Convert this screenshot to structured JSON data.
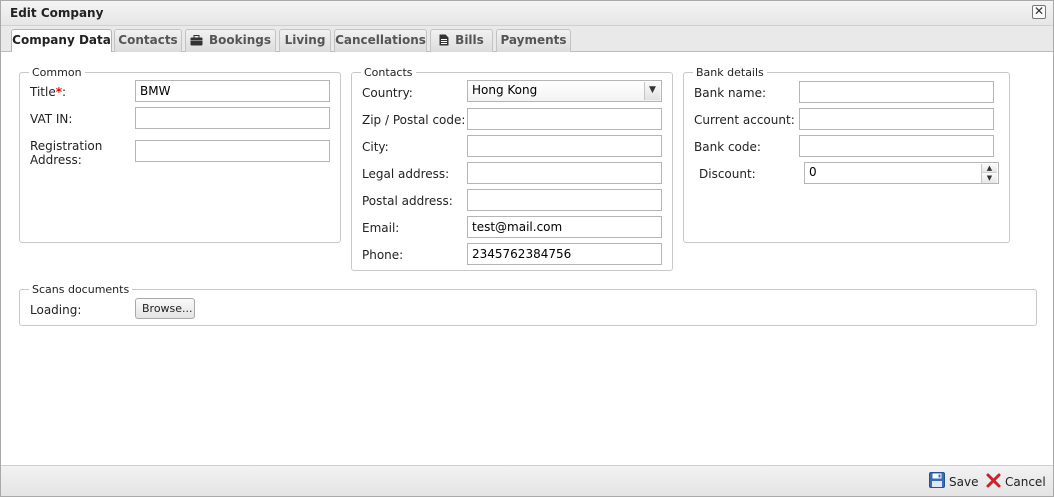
{
  "window": {
    "title": "Edit Company",
    "close_glyph": "✕"
  },
  "tabs": [
    {
      "label": "Company Data",
      "active": true
    },
    {
      "label": "Contacts"
    },
    {
      "label": "Bookings",
      "icon": "briefcase-icon"
    },
    {
      "label": "Living"
    },
    {
      "label": "Cancellations"
    },
    {
      "label": "Bills",
      "icon": "document-icon"
    },
    {
      "label": "Payments"
    }
  ],
  "common": {
    "legend": "Common",
    "title_label": "Title",
    "required_mark": "*",
    "title_colon": ":",
    "title_value": "BMW",
    "vat_label": "VAT IN:",
    "vat_value": "",
    "reg_label_line1": "Registration",
    "reg_label_line2": "Address:",
    "reg_value": ""
  },
  "contacts": {
    "legend": "Contacts",
    "country_label": "Country:",
    "country_value": "Hong Kong",
    "zip_label": "Zip / Postal code:",
    "zip_value": "",
    "city_label": "City:",
    "city_value": "",
    "legal_label": "Legal address:",
    "legal_value": "",
    "postal_label": "Postal address:",
    "postal_value": "",
    "email_label": "Email:",
    "email_value": "test@mail.com",
    "phone_label": "Phone:",
    "phone_value": "2345762384756"
  },
  "bank": {
    "legend": "Bank details",
    "bank_name_label": "Bank name:",
    "bank_name_value": "",
    "current_account_label": "Current account:",
    "current_account_value": "",
    "bank_code_label": "Bank code:",
    "bank_code_value": "",
    "discount_label": "Discount:",
    "discount_value": "0"
  },
  "scans": {
    "legend": "Scans documents",
    "loading_label": "Loading:",
    "browse_label": "Browse..."
  },
  "footer": {
    "save_label": "Save",
    "cancel_label": "Cancel"
  },
  "colors": {
    "required": "#ee0000",
    "save_icon": "#3a6db5",
    "cancel_icon": "#d0202a"
  }
}
